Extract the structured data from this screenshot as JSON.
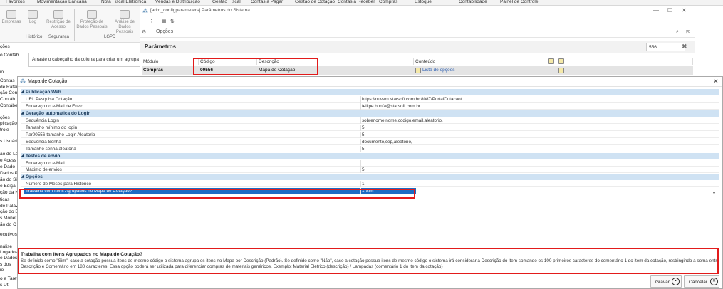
{
  "menubar": [
    "Favoritos",
    "Movimentação Bancária",
    "Nota Fiscal Eletrônica",
    "Vendas e Distribuição",
    "Gestão Fiscal",
    "Contas a Pagar",
    "Gestão de Cotação",
    "Contas a Receber",
    "Compras",
    "Estoque",
    "Contabilidade",
    "Painel de Controle"
  ],
  "ribbon": {
    "buttons": [
      {
        "label": "Empresas"
      },
      {
        "label": "Log"
      },
      {
        "label": "Restrição de Acesso"
      },
      {
        "label": "Proteção de Dados Pessoais"
      },
      {
        "label": "Análise de Dados Pessoais"
      }
    ],
    "groups": [
      "Histórico",
      "Segurança",
      "LGPD"
    ]
  },
  "leftnav": [
    "ções",
    "o Contábil",
    "io",
    "Contas",
    "de Rateio",
    "ção Con",
    "Contáb",
    "Contábe",
    "ções",
    "plicação",
    "trole",
    "s Usuário",
    "ão do Lo",
    "e Acess",
    "e Dado",
    "Dados P",
    "ão do Sis",
    "e Ediçã",
    "ção da N",
    "ticas",
    "de Palav",
    "ção do E",
    "s Monet",
    "ão do C",
    "ecutivos",
    "nálise",
    "Logados",
    "e Dados",
    "s dos",
    "io",
    "o e Taref",
    "s Ut",
    "s do De"
  ],
  "groupbar_text": "Arraste o cabeçalho da coluna para criar um agrupa",
  "params_window": {
    "title": "[adm_configparameters] Parâmetros do Sistema",
    "toolbar_options": "Opções",
    "header": "Parâmetros",
    "search_value": "556",
    "columns": [
      "Módulo",
      "Código",
      "Descrição",
      "Conteúdo"
    ],
    "row": {
      "modulo": "Compras",
      "codigo": "00556",
      "descricao": "Mapa de Cotação",
      "conteudo": "Lista de opções"
    }
  },
  "dialog": {
    "title": "Mapa de Cotação",
    "categories": [
      {
        "name": "Publicação Web",
        "items": [
          {
            "name": "URL Pesquisa Cotação",
            "value": "https://nuvem.starsoft.com.br:8087/PortalCotacao/"
          },
          {
            "name": "Endereço do e-Mail de Envio",
            "value": "fellipe.bonfa@starsoft.com.br"
          }
        ]
      },
      {
        "name": "Geração automática do Login",
        "items": [
          {
            "name": "Sequência Login",
            "value": "sobrenome,nome,codigo,email,aleatorio,"
          },
          {
            "name": "Tamanho mínimo do login",
            "value": "5"
          },
          {
            "name": "Par00556-tamanho Login Aleatorio",
            "value": "5"
          },
          {
            "name": "Sequência Senha",
            "value": "documento,cep,aleatorio,"
          },
          {
            "name": "Tamanho senha aleatória",
            "value": "5"
          }
        ]
      },
      {
        "name": "Testes de envio",
        "items": [
          {
            "name": "Endereço do e-Mail",
            "value": ""
          },
          {
            "name": "Máximo de envios",
            "value": "5"
          }
        ]
      },
      {
        "name": "Opções",
        "items": [
          {
            "name": "Número de Meses para Histórico",
            "value": "1"
          },
          {
            "name": "Trabalha com Itens Agrupados no Mapa de Cotação?",
            "value": "1-Sim",
            "selected": true
          }
        ]
      }
    ],
    "description_title": "Trabalha com Itens Agrupados no Mapa de Cotação?",
    "description_body": "Se definido como \"Sim\", caso a cotação possua itens de mesmo código o sistema agrupa os itens no Mapa por Descrição (Padrão). Se definido como \"Não\", caso a cotação possua itens de mesmo código o sistema irá considerar a Descrição do item somando os 100 primeiros caracteres do comentário 1 do item da cotação, restringindo a soma entre Descrição e Comentário em 180 caracteres. Essa opção poderá ser utilizada para diferenciar compras de materiais genéricos. Exemplo: Material Elétrico (descrição) / Lampadas (comentário 1 do item da cotação)",
    "save_label": "Gravar",
    "cancel_label": "Cancelar"
  }
}
